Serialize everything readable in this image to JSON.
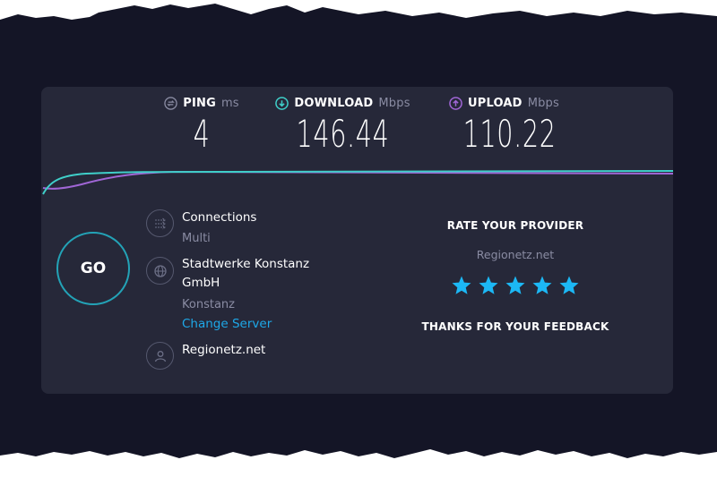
{
  "metrics": {
    "ping": {
      "label": "PING",
      "unit": "ms",
      "value": "4",
      "icon": "ping-icon",
      "color": "#8a8ca3"
    },
    "download": {
      "label": "DOWNLOAD",
      "unit": "Mbps",
      "value": "146.44",
      "icon": "download-arrow-icon",
      "color": "#3fcfc9"
    },
    "upload": {
      "label": "UPLOAD",
      "unit": "Mbps",
      "value": "110.22",
      "icon": "upload-arrow-icon",
      "color": "#a066d6"
    }
  },
  "go_button": {
    "label": "GO"
  },
  "connections": {
    "title": "Connections",
    "value": "Multi"
  },
  "server": {
    "name_line1": "Stadtwerke Konstanz",
    "name_line2": "GmbH",
    "location": "Konstanz",
    "change_label": "Change Server"
  },
  "provider": {
    "name": "Regionetz.net"
  },
  "rating": {
    "title": "RATE YOUR PROVIDER",
    "provider": "Regionetz.net",
    "stars_filled": 5,
    "stars_total": 5,
    "star_color": "#1cb8f5",
    "thanks": "THANKS FOR YOUR FEEDBACK"
  },
  "colors": {
    "background": "#141526",
    "panel": "#262839",
    "download_line": "#3fcfc9",
    "upload_line": "#a066d6",
    "link": "#1ea8e8"
  }
}
